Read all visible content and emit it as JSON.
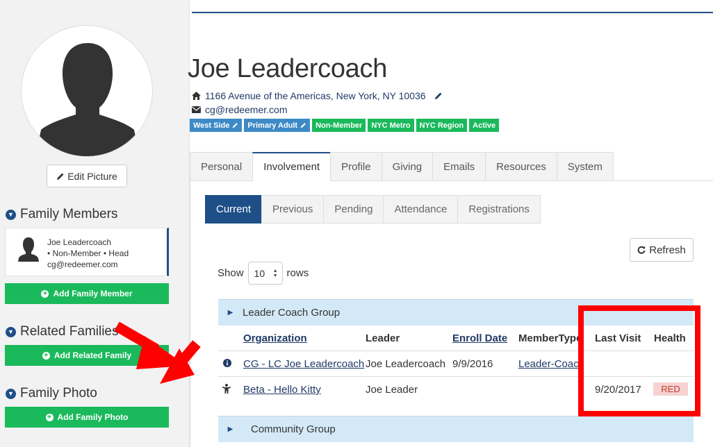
{
  "person": {
    "name": "Joe Leadercoach",
    "address": "1166 Avenue of the Americas, New York, NY 10036",
    "email": "cg@redeemer.com"
  },
  "tags": [
    {
      "label": "West Side",
      "color": "#3d8ac7",
      "editable": true
    },
    {
      "label": "Primary Adult",
      "color": "#3d8ac7",
      "editable": true
    },
    {
      "label": "Non-Member",
      "color": "#1ab95b"
    },
    {
      "label": "NYC Metro",
      "color": "#1ab95b"
    },
    {
      "label": "NYC Region",
      "color": "#1ab95b"
    },
    {
      "label": "Active",
      "color": "#1ab95b"
    }
  ],
  "sidebar": {
    "edit_picture_label": "Edit Picture",
    "family_members_heading": "Family Members",
    "family_member": {
      "name": "Joe Leadercoach",
      "status": "• Non-Member • Head",
      "email": "cg@redeemer.com"
    },
    "add_family_member_label": "Add Family Member",
    "related_families_heading": "Related Families",
    "add_related_family_label": "Add Related Family",
    "family_photo_heading": "Family Photo",
    "add_family_photo_label": "Add Family Photo"
  },
  "main_tabs": [
    {
      "label": "Personal"
    },
    {
      "label": "Involvement",
      "active": true
    },
    {
      "label": "Profile"
    },
    {
      "label": "Giving"
    },
    {
      "label": "Emails"
    },
    {
      "label": "Resources"
    },
    {
      "label": "System"
    }
  ],
  "sub_tabs": [
    {
      "label": "Current",
      "active": true
    },
    {
      "label": "Previous"
    },
    {
      "label": "Pending"
    },
    {
      "label": "Attendance"
    },
    {
      "label": "Registrations"
    }
  ],
  "toolbar": {
    "refresh_label": "Refresh",
    "show_label": "Show",
    "rows_value": "10",
    "rows_label": "rows"
  },
  "table": {
    "group1": "Leader Coach Group",
    "headers": {
      "organization": "Organization",
      "leader": "Leader",
      "enroll_date": "Enroll Date",
      "member_type": "MemberType",
      "last_visit": "Last Visit",
      "health": "Health"
    },
    "rows": [
      {
        "organization": "CG - LC Joe Leadercoach",
        "leader": "Joe Leadercoach",
        "enroll_date": "9/9/2016",
        "member_type": "Leader-Coach",
        "last_visit": "",
        "health": "",
        "icon": "info-icon"
      },
      {
        "organization": "Beta - Hello Kitty",
        "leader": "Joe Leader",
        "enroll_date": "",
        "member_type": "",
        "last_visit": "9/20/2017",
        "health": "RED",
        "icon": "child-icon"
      }
    ],
    "group2": "Community Group"
  },
  "colors": {
    "primary": "#1e4f87",
    "success": "#1ab95b",
    "group_bg": "#d4e9f7",
    "annotation": "#ff0000"
  }
}
